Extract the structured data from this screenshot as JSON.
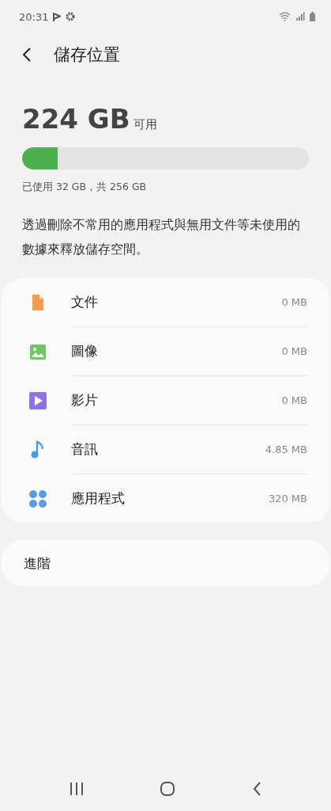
{
  "status_bar": {
    "time": "20:31"
  },
  "header": {
    "title": "儲存位置"
  },
  "storage": {
    "available": "224 GB",
    "available_label": "可用",
    "level": 0.125,
    "usage": "已使用 32 GB，共 256 GB"
  },
  "description": "透過刪除不常用的應用程式與無用文件等未使用的數據來釋放儲存空間。",
  "categories": [
    {
      "kind": "documents",
      "label": "文件",
      "size": "0 MB"
    },
    {
      "kind": "images",
      "label": "圖像",
      "size": "0 MB"
    },
    {
      "kind": "videos",
      "label": "影片",
      "size": "0 MB"
    },
    {
      "kind": "audio",
      "label": "音訊",
      "size": "4.85 MB"
    },
    {
      "kind": "apps",
      "label": "應用程式",
      "size": "320 MB"
    }
  ],
  "advanced": {
    "label": "進階"
  }
}
